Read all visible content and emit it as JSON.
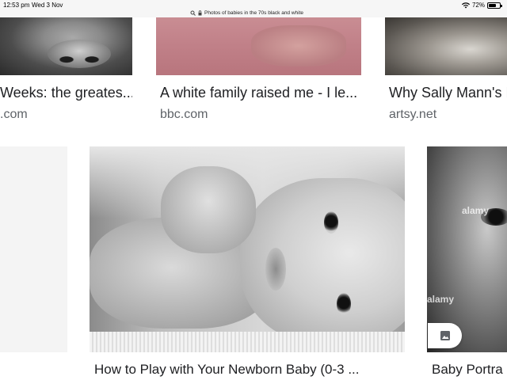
{
  "status_bar": {
    "time": "12:53 pm",
    "date": "Wed 3 Nov",
    "battery_percent": "72%",
    "battery_level": 0.72
  },
  "browser": {
    "url_text": "Photos of babies in the 70s black and white"
  },
  "top_results": [
    {
      "title": "Weeks: the greates...",
      "source": ".com"
    },
    {
      "title": "A white family raised me - I le...",
      "source": "bbc.com"
    },
    {
      "title": "Why Sally Mann's P",
      "source": "artsy.net"
    }
  ],
  "bottom_results": [
    {
      "title": "How to Play with Your Newborn Baby (0-3 ..."
    },
    {
      "title": "Baby Portra",
      "watermark": "alamy"
    }
  ],
  "colors": {
    "status_bar_bg": "#f6f6f6",
    "title_text": "#202124",
    "source_text": "#5f6368"
  }
}
